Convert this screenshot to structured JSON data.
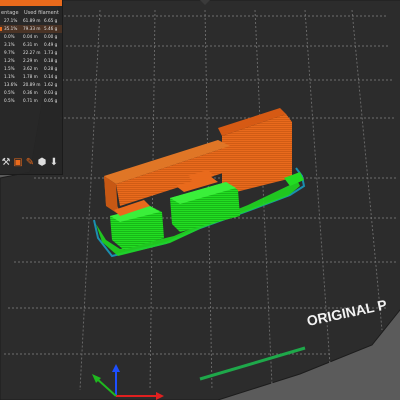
{
  "app": "PrusaSlicer",
  "stats_panel": {
    "headers": {
      "percentage": "entage",
      "used_filament": "Used filament"
    },
    "rows": [
      {
        "percentage": "27.1%",
        "length": "61.89 m",
        "weight": "6.65 g",
        "highlight": false
      },
      {
        "percentage": "35.1%",
        "length": "79.33 m",
        "weight": "5.46 g",
        "highlight": true
      },
      {
        "percentage": "0.0%",
        "length": "0.04 m",
        "weight": "0.00 g",
        "highlight": false
      },
      {
        "percentage": "3.1%",
        "length": "6.31 m",
        "weight": "0.49 g",
        "highlight": false
      },
      {
        "percentage": "9.7%",
        "length": "22.27 m",
        "weight": "1.73 g",
        "highlight": false
      },
      {
        "percentage": "1.2%",
        "length": "2.29 m",
        "weight": "0.18 g",
        "highlight": false
      },
      {
        "percentage": "1.5%",
        "length": "3.62 m",
        "weight": "0.28 g",
        "highlight": false
      },
      {
        "percentage": "1.1%",
        "length": "1.78 m",
        "weight": "0.14 g",
        "highlight": false
      },
      {
        "percentage": "13.6%",
        "length": "20.89 m",
        "weight": "1.62 g",
        "highlight": false
      },
      {
        "percentage": "0.5%",
        "length": "0.36 m",
        "weight": "0.03 g",
        "highlight": false
      },
      {
        "percentage": "0.5%",
        "length": "0.71 m",
        "weight": "0.05 g",
        "highlight": false
      }
    ],
    "icons": [
      "wrench-icon",
      "cube-icon",
      "brush-icon",
      "sphere-icon",
      "export-icon"
    ]
  },
  "bed": {
    "label": "ORIGINAL P",
    "colors": {
      "bed": "#2c2c2c",
      "grid": "#6e6e6e",
      "model_orange": "#e96a1c",
      "model_green": "#1fd71f",
      "travel": "#1a8fb0"
    }
  }
}
